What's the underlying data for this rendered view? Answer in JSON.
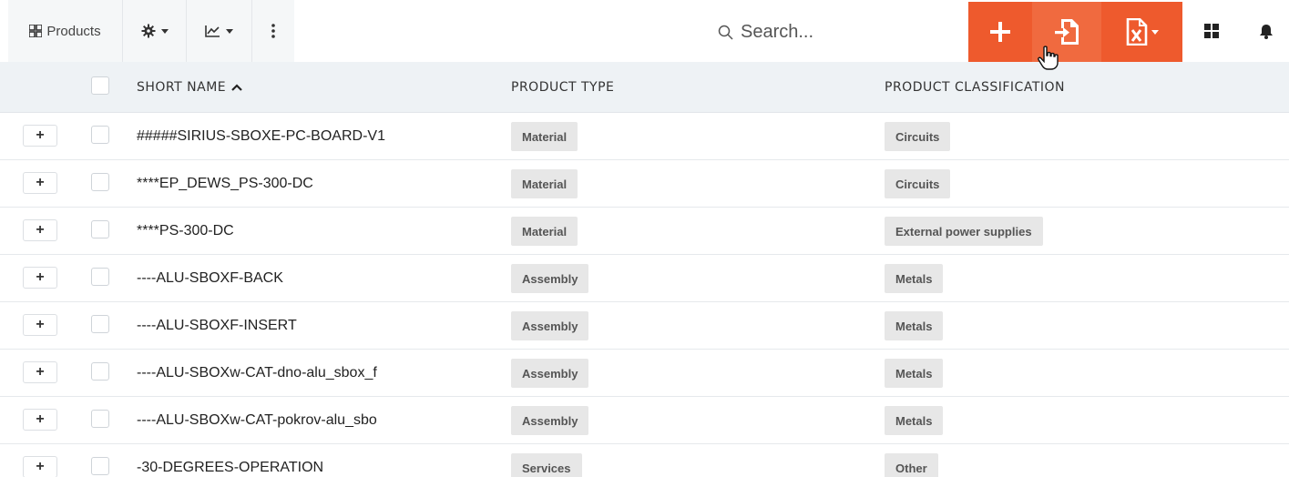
{
  "toolbar": {
    "products_label": "Products",
    "search_placeholder": "Search...",
    "accent_color": "#ee5a2d",
    "icons": {
      "products": "grid-icon",
      "settings": "gear-icon",
      "chart": "chart-icon",
      "more": "kebab-icon",
      "add": "plus-icon",
      "import": "import-file-icon",
      "excel": "excel-file-icon",
      "layout": "dashboard-icon",
      "notifications": "bell-icon"
    }
  },
  "table": {
    "headers": {
      "short_name": "SHORT NAME",
      "product_type": "PRODUCT TYPE",
      "product_classification": "PRODUCT CLASSIFICATION"
    },
    "sort_column": "SHORT NAME",
    "sort_direction": "ascending",
    "rows": [
      {
        "name": "#####SIRIUS-SBOXE-PC-BOARD-V1",
        "type": "Material",
        "classification": "Circuits"
      },
      {
        "name": "****EP_DEWS_PS-300-DC",
        "type": "Material",
        "classification": "Circuits"
      },
      {
        "name": "****PS-300-DC",
        "type": "Material",
        "classification": "External power supplies"
      },
      {
        "name": "----ALU-SBOXF-BACK",
        "type": "Assembly",
        "classification": "Metals"
      },
      {
        "name": "----ALU-SBOXF-INSERT",
        "type": "Assembly",
        "classification": "Metals"
      },
      {
        "name": "----ALU-SBOXw-CAT-dno-alu_sbox_f",
        "type": "Assembly",
        "classification": "Metals"
      },
      {
        "name": "----ALU-SBOXw-CAT-pokrov-alu_sbo",
        "type": "Assembly",
        "classification": "Metals"
      },
      {
        "name": "-30-DEGREES-OPERATION",
        "type": "Services",
        "classification": "Other"
      }
    ]
  },
  "expand_symbol": "+"
}
